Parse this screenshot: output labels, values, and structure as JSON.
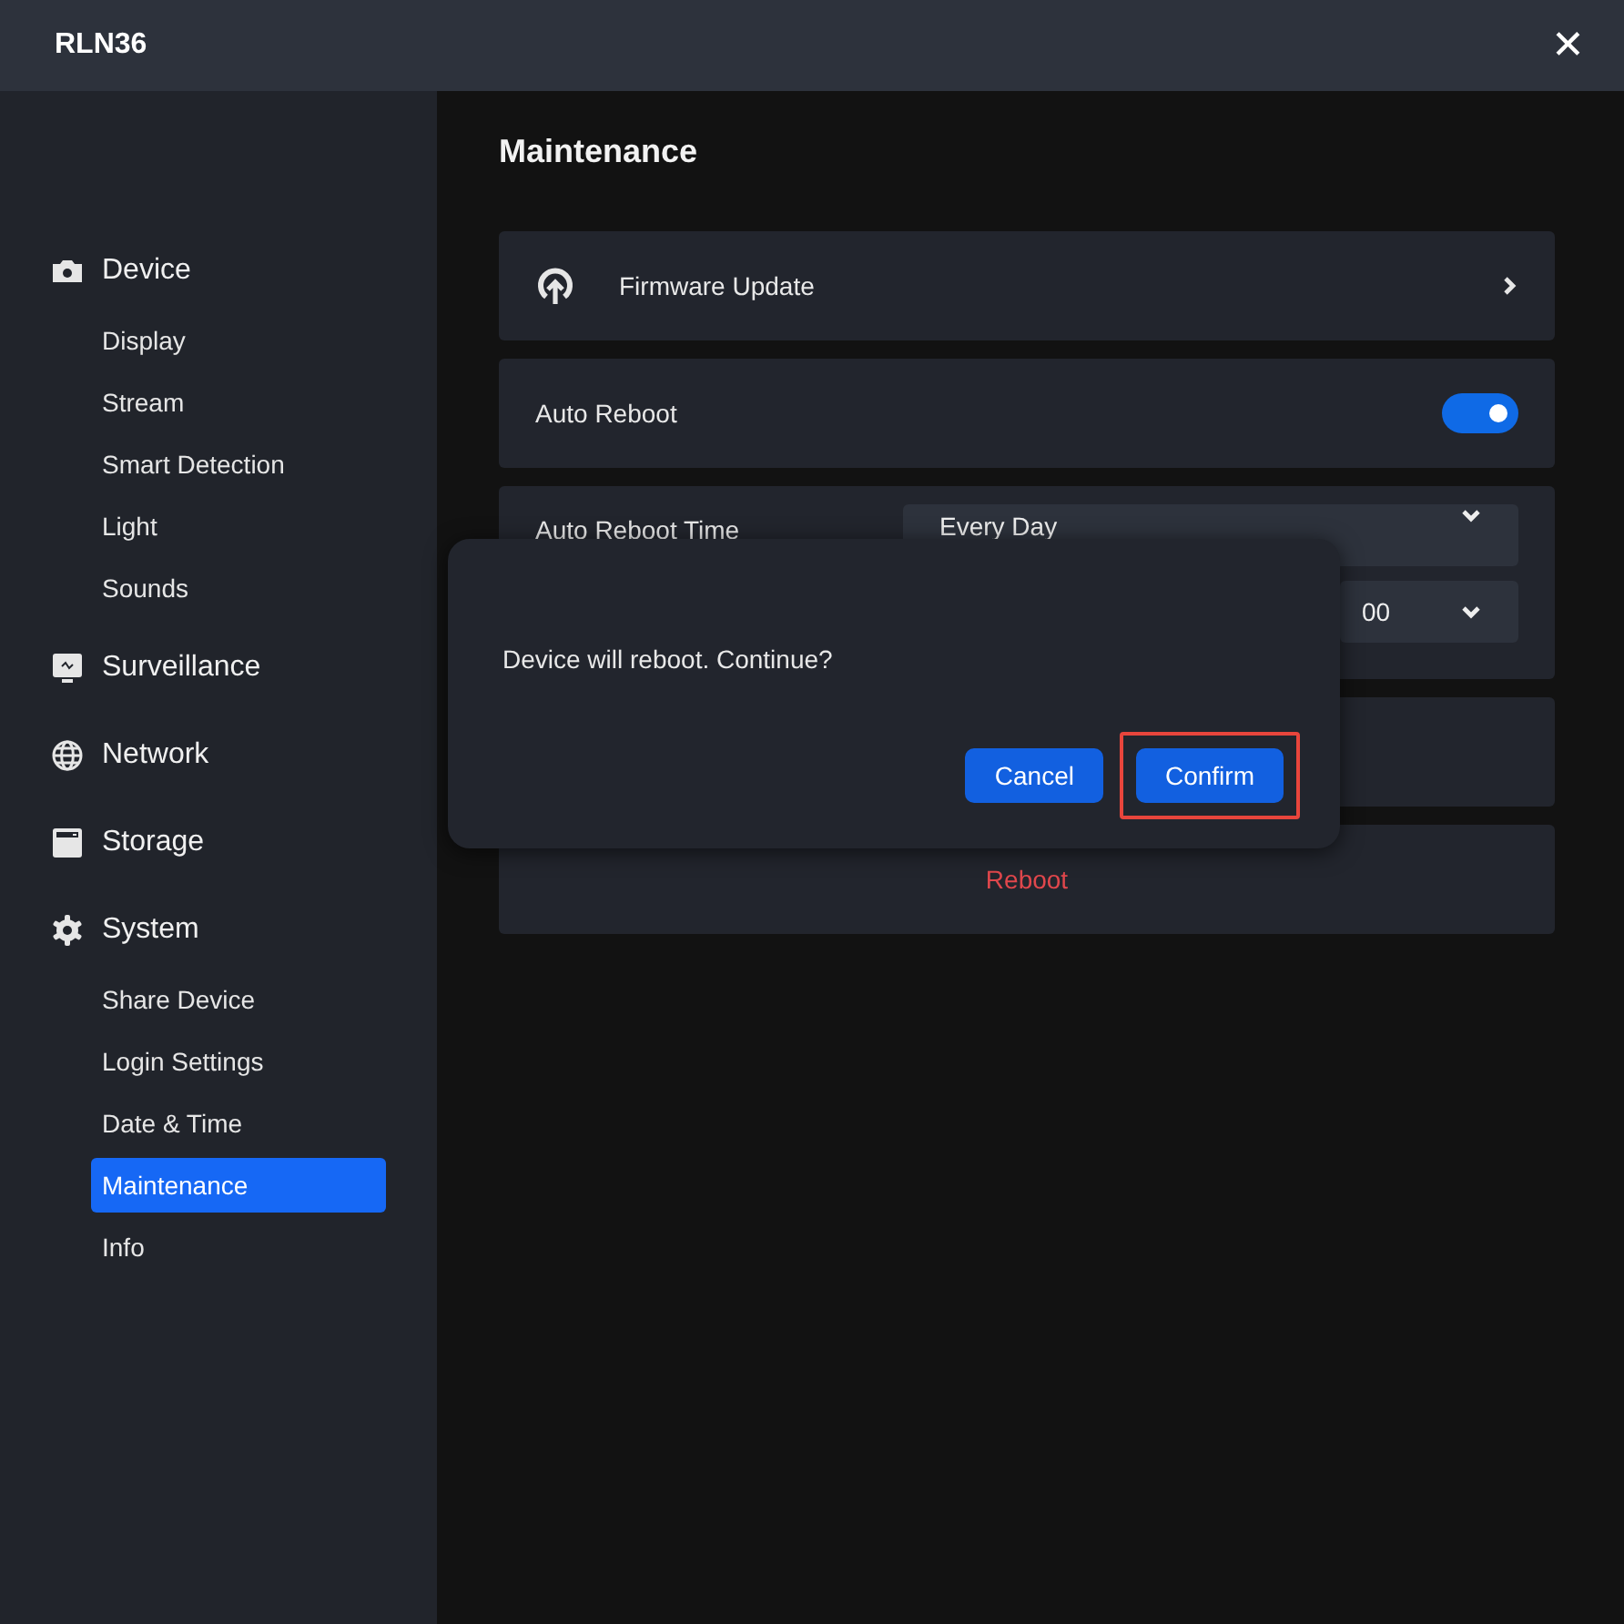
{
  "window": {
    "title": "RLN36",
    "close": "✕"
  },
  "sidebar": {
    "groups": [
      {
        "label": "Device",
        "items": [
          {
            "label": "Display",
            "selected": false
          },
          {
            "label": "Stream",
            "selected": false
          },
          {
            "label": "Smart Detection",
            "selected": false
          },
          {
            "label": "Light",
            "selected": false
          },
          {
            "label": "Sounds",
            "selected": false
          }
        ]
      },
      {
        "label": "Surveillance"
      },
      {
        "label": "Network"
      },
      {
        "label": "Storage"
      },
      {
        "label": "System",
        "items": [
          {
            "label": "Share Device",
            "selected": false
          },
          {
            "label": "Login Settings",
            "selected": false
          },
          {
            "label": "Date & Time",
            "selected": false
          },
          {
            "label": "Maintenance",
            "selected": true
          },
          {
            "label": "Info",
            "selected": false
          }
        ]
      }
    ]
  },
  "page_title": "Maintenance",
  "firmware": {
    "label": "Firmware Update"
  },
  "auto_reboot": {
    "label": "Auto Reboot",
    "on": true
  },
  "auto_reboot_time": {
    "label": "Auto Reboot Time",
    "frequency": "Every Day",
    "minute": "00"
  },
  "reboot": {
    "label": "Reboot"
  },
  "dialog": {
    "message": "Device will reboot. Continue?",
    "buttons": [
      {
        "label": "Cancel",
        "highlighted": false
      },
      {
        "label": "Confirm",
        "highlighted": true
      }
    ]
  }
}
